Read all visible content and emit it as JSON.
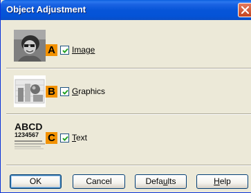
{
  "window": {
    "title": "Object Adjustment"
  },
  "options": [
    {
      "key": "image",
      "letter": "A",
      "label": "Image",
      "checked": true,
      "thumb_icon": "photo-woman-icon"
    },
    {
      "key": "graphics",
      "letter": "B",
      "label": "Graphics",
      "checked": true,
      "thumb_icon": "graphics-chart-icon"
    },
    {
      "key": "text",
      "letter": "C",
      "label": "Text",
      "checked": true,
      "thumb_icon": "text-sample-icon",
      "thumb_line1": "ABCD",
      "thumb_line2": "1234567"
    }
  ],
  "buttons": {
    "ok": "OK",
    "cancel": "Cancel",
    "defaults": "Defaults",
    "help": "Help"
  },
  "colors": {
    "titlebar": "#0453d7",
    "dialog_bg": "#ece9d8",
    "badge": "#f39200",
    "close_button": "#c5451f"
  }
}
